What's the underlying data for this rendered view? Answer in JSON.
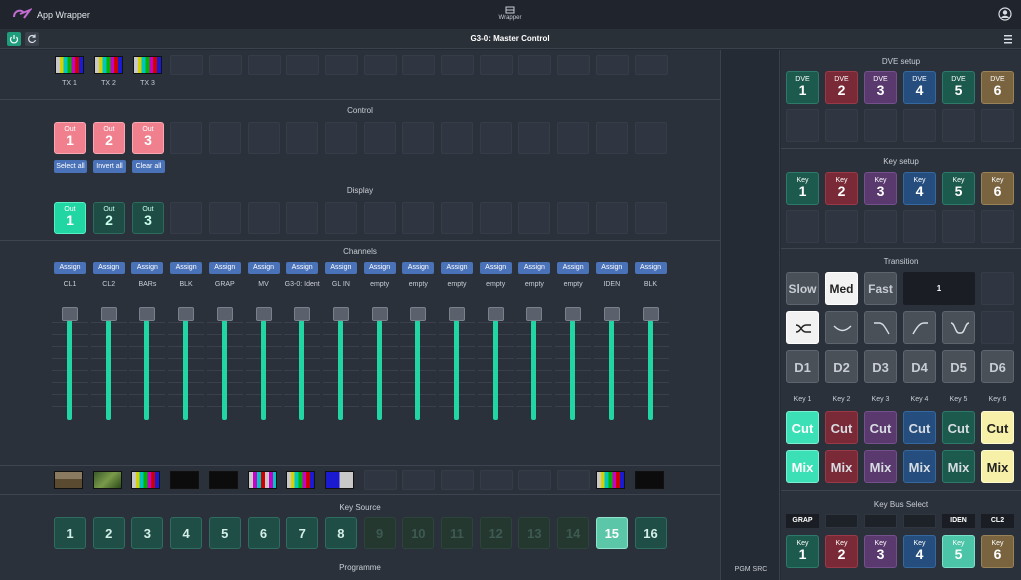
{
  "app": {
    "title": "App Wrapper",
    "center_label": "Wrapper",
    "panel_title": "G3-0: Master Control"
  },
  "tx": {
    "labels": [
      "TX 1",
      "TX 2",
      "TX 3"
    ]
  },
  "control": {
    "title": "Control",
    "outs": [
      {
        "top": "Out",
        "num": "1"
      },
      {
        "top": "Out",
        "num": "2"
      },
      {
        "top": "Out",
        "num": "3"
      }
    ],
    "select_all": "Select all",
    "invert_all": "Invert all",
    "clear_all": "Clear all"
  },
  "display": {
    "title": "Display",
    "outs": [
      {
        "top": "Out",
        "num": "1"
      },
      {
        "top": "Out",
        "num": "2"
      },
      {
        "top": "Out",
        "num": "3"
      }
    ]
  },
  "channels": {
    "title": "Channels",
    "assign_label": "Assign",
    "labels": [
      "CL1",
      "CL2",
      "BARs",
      "BLK",
      "GRAP",
      "MV",
      "G3-0: Ident",
      "GL IN",
      "empty",
      "empty",
      "empty",
      "empty",
      "empty",
      "empty",
      "IDEN",
      "BLK"
    ]
  },
  "key_source": {
    "title": "Key Source",
    "numbers": [
      "1",
      "2",
      "3",
      "4",
      "5",
      "6",
      "7",
      "8",
      "9",
      "10",
      "11",
      "12",
      "13",
      "14",
      "15",
      "16"
    ],
    "active": 15
  },
  "programme": {
    "title": "Programme"
  },
  "pgm_src": "PGM SRC",
  "dve_setup": {
    "title": "DVE setup",
    "prefix": "DVE",
    "nums": [
      "1",
      "2",
      "3",
      "4",
      "5",
      "6"
    ]
  },
  "key_setup": {
    "title": "Key setup",
    "prefix": "Key",
    "nums": [
      "1",
      "2",
      "3",
      "4",
      "5",
      "6"
    ]
  },
  "transition": {
    "title": "Transition",
    "speeds": [
      "Slow",
      "Med",
      "Fast"
    ],
    "selected_speed": "Med",
    "rate_value": "1",
    "d_buttons": [
      "D1",
      "D2",
      "D3",
      "D4",
      "D5",
      "D6"
    ],
    "key_labels": [
      "Key 1",
      "Key 2",
      "Key 3",
      "Key 4",
      "Key 5",
      "Key 6"
    ],
    "cut_label": "Cut",
    "mix_label": "Mix"
  },
  "key_bus_select": {
    "title": "Key Bus Select",
    "bus_labels": [
      "GRAP",
      "",
      "",
      "",
      "IDEN",
      "CL2"
    ],
    "prefix": "Key",
    "nums": [
      "1",
      "2",
      "3",
      "4",
      "5",
      "6"
    ]
  },
  "colors": {
    "accent_green": "#22d6a4",
    "pink": "#f1808f",
    "assign_blue": "#4a72b8"
  }
}
